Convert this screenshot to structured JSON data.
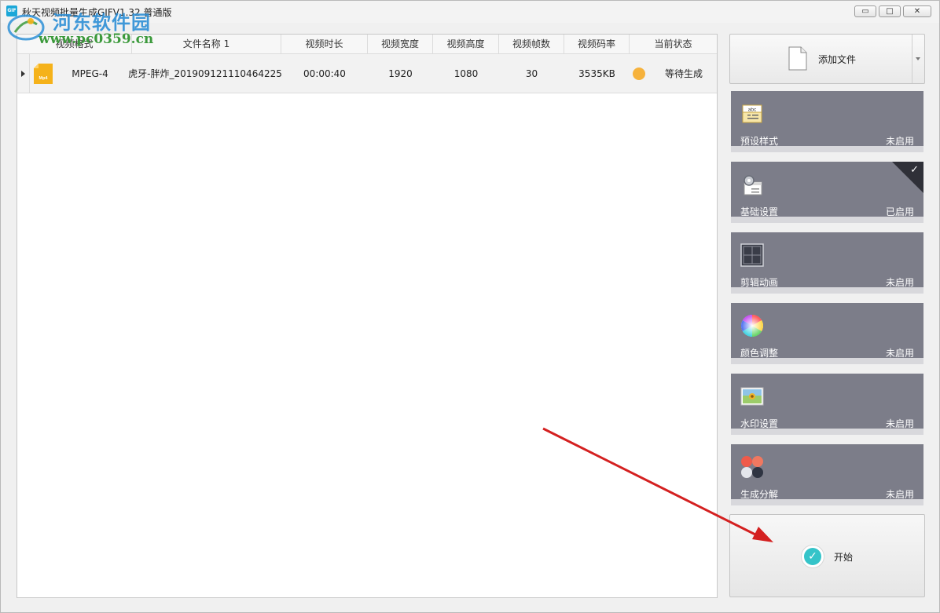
{
  "window": {
    "title": "秋天视频批量生成GIFV1.32 普通版",
    "app_icon_text": "GIF",
    "controls": {
      "minimize": "▭",
      "maximize": "□",
      "close": "✕"
    }
  },
  "watermark": {
    "title": "河东软件园",
    "url": "www.pc0359.cn"
  },
  "table": {
    "columns": [
      "视频格式",
      "文件名称 1",
      "视频时长",
      "视频宽度",
      "视频高度",
      "视频帧数",
      "视频码率",
      "当前状态"
    ],
    "rows": [
      {
        "format": "MPEG-4",
        "file_icon_text": "Mp4",
        "filename": "虎牙-胖炸_20190912111046​4225",
        "duration": "00:00:40",
        "width": "1920",
        "height": "1080",
        "frames": "30",
        "bitrate": "3535KB",
        "status": "等待生成",
        "status_color": "#f6b23c"
      }
    ]
  },
  "sidebar": {
    "add_file_label": "添加文件",
    "features": [
      {
        "name": "预设样式",
        "status": "未启用",
        "icon": "abc-text-icon",
        "enabled": false
      },
      {
        "name": "基础设置",
        "status": "已启用",
        "icon": "gear-settings-icon",
        "enabled": true
      },
      {
        "name": "剪辑动画",
        "status": "未启用",
        "icon": "crop-frame-icon",
        "enabled": false
      },
      {
        "name": "颜色调整",
        "status": "未启用",
        "icon": "color-wheel-icon",
        "enabled": false
      },
      {
        "name": "水印设置",
        "status": "未启用",
        "icon": "picture-watermark-icon",
        "enabled": false
      },
      {
        "name": "生成分解",
        "status": "未启用",
        "icon": "four-dots-icon",
        "enabled": false
      }
    ],
    "start_label": "开始"
  },
  "colors": {
    "feature_bg": "#7c7d89",
    "accent_teal": "#35c4c9",
    "annotation_arrow": "#d42020"
  }
}
